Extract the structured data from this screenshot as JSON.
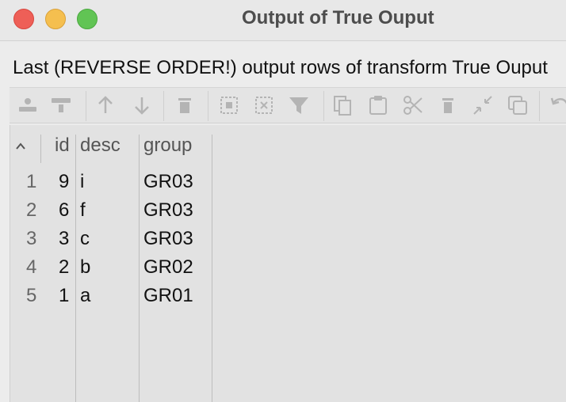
{
  "window": {
    "title": "Output of True Ouput"
  },
  "header": {
    "text": "Last (REVERSE ORDER!) output rows of transform True Ouput"
  },
  "toolbar": {
    "buttons": [
      {
        "icon": "insert-row-icon"
      },
      {
        "icon": "delete-row-icon"
      },
      {
        "icon": "arrow-up-icon"
      },
      {
        "icon": "arrow-down-icon"
      },
      {
        "icon": "trash-icon"
      },
      {
        "icon": "select-all-icon"
      },
      {
        "icon": "clear-selection-icon"
      },
      {
        "icon": "filter-icon"
      },
      {
        "icon": "copy-icon"
      },
      {
        "icon": "paste-icon"
      },
      {
        "icon": "cut-icon"
      },
      {
        "icon": "delete-icon"
      },
      {
        "icon": "collapse-icon"
      },
      {
        "icon": "duplicate-icon"
      },
      {
        "icon": "undo-icon"
      }
    ]
  },
  "table": {
    "columns": [
      "id",
      "desc",
      "group"
    ],
    "rows": [
      {
        "num": "1",
        "id": "9",
        "desc": "i",
        "group": "GR03"
      },
      {
        "num": "2",
        "id": "6",
        "desc": "f",
        "group": "GR03"
      },
      {
        "num": "3",
        "id": "3",
        "desc": "c",
        "group": "GR03"
      },
      {
        "num": "4",
        "id": "2",
        "desc": "b",
        "group": "GR02"
      },
      {
        "num": "5",
        "id": "1",
        "desc": "a",
        "group": "GR01"
      }
    ]
  },
  "colors": {
    "close": "#ee5f57",
    "minimize": "#f5bf4f",
    "maximize": "#61c454",
    "icon_disabled": "#b4b4b4"
  }
}
